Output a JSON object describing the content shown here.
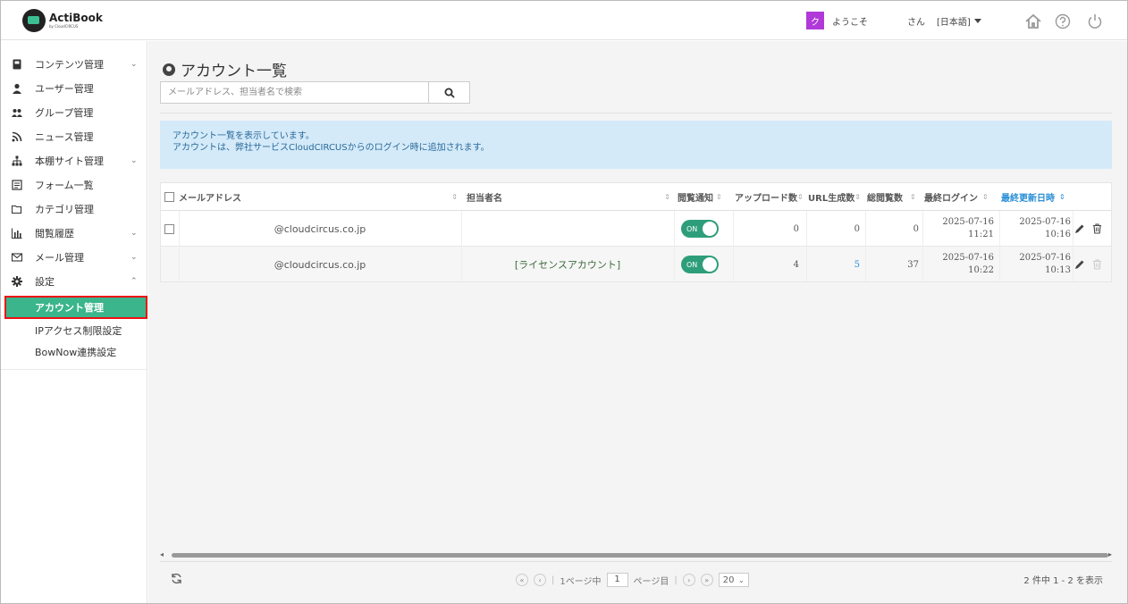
{
  "header": {
    "logo_title": "ActiBook",
    "logo_sub": "by CloudCIRCUS",
    "avatar_initial": "ク",
    "welcome": "ようこそ",
    "san": "さん",
    "language": "[日本語]",
    "icons": [
      "home-icon",
      "help-icon",
      "power-icon"
    ]
  },
  "sidebar": {
    "items": [
      {
        "label": "コンテンツ管理",
        "icon": "book-icon",
        "chevron": "⌄"
      },
      {
        "label": "ユーザー管理",
        "icon": "user-icon",
        "chevron": ""
      },
      {
        "label": "グループ管理",
        "icon": "users-icon",
        "chevron": ""
      },
      {
        "label": "ニュース管理",
        "icon": "rss-icon",
        "chevron": ""
      },
      {
        "label": "本棚サイト管理",
        "icon": "sitemap-icon",
        "chevron": "⌄"
      },
      {
        "label": "フォーム一覧",
        "icon": "form-icon",
        "chevron": ""
      },
      {
        "label": "カテゴリ管理",
        "icon": "folder-icon",
        "chevron": ""
      },
      {
        "label": "閲覧履歴",
        "icon": "bar-chart-icon",
        "chevron": "⌄"
      },
      {
        "label": "メール管理",
        "icon": "mail-icon",
        "chevron": "⌄"
      },
      {
        "label": "設定",
        "icon": "gear-icon",
        "chevron": "⌃"
      }
    ],
    "sub_items": [
      "アカウント管理",
      "IPアクセス制限設定",
      "BowNow連携設定"
    ],
    "active": "アカウント管理"
  },
  "main": {
    "title": "アカウント一覧",
    "search": {
      "placeholder": "メールアドレス、担当者名で検索"
    },
    "info_line1": "アカウント一覧を表示しています。",
    "info_line2": "アカウントは、弊社サービスCloudCIRCUSからのログイン時に追加されます。",
    "table": {
      "headers": {
        "email": "メールアドレス",
        "person": "担当者名",
        "notify": "閲覧通知",
        "uploads": "アップロード数",
        "urls": "URL生成数",
        "views": "総閲覧数",
        "last_login": "最終ログイン",
        "updated": "最終更新日時"
      },
      "rows": [
        {
          "email": "@cloudcircus.co.jp",
          "person": "",
          "notify": "ON",
          "uploads": "0",
          "urls": "0",
          "views": "0",
          "login_date": "2025-07-16",
          "login_time": "11:21",
          "upd_date": "2025-07-16",
          "upd_time": "10:16"
        },
        {
          "email": "@cloudcircus.co.jp",
          "person": "[ライセンスアカウント]",
          "notify": "ON",
          "uploads": "4",
          "urls": "5",
          "views": "37",
          "login_date": "2025-07-16",
          "login_time": "10:22",
          "upd_date": "2025-07-16",
          "upd_time": "10:13"
        }
      ]
    },
    "pager": {
      "page_prefix": "1ページ中",
      "page_value": "1",
      "page_suffix": "ページ目",
      "page_size": "20",
      "count_text": "2 件中 1 - 2 を表示"
    },
    "colors": {
      "accent": "#3bb58b",
      "info_bg": "#d4eaf9",
      "link": "#2a8fd6"
    }
  }
}
